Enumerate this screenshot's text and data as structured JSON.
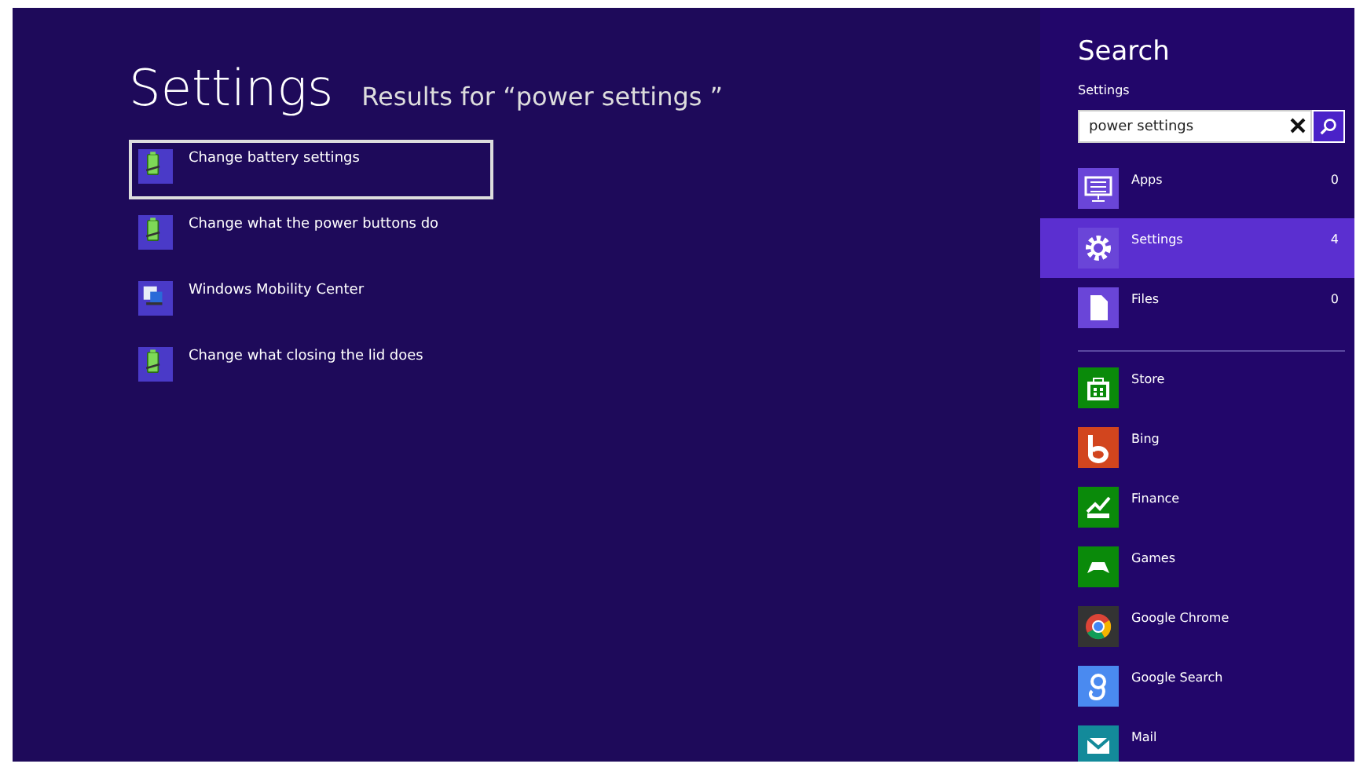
{
  "title": "Settings",
  "subtitle": "Results for “power settings ”",
  "results": [
    {
      "label": "Change battery settings",
      "kind": "battery",
      "selected": true
    },
    {
      "label": "Change what the power buttons do",
      "kind": "battery",
      "selected": false
    },
    {
      "label": "Windows Mobility Center",
      "kind": "mobility",
      "selected": false
    },
    {
      "label": "Change what closing the lid does",
      "kind": "battery",
      "selected": false
    }
  ],
  "search_pane": {
    "title": "Search",
    "scope": "Settings",
    "query": "power settings",
    "scopes": [
      {
        "label": "Apps",
        "count": "0",
        "kind": "apps",
        "selected": false
      },
      {
        "label": "Settings",
        "count": "4",
        "kind": "settings",
        "selected": true
      },
      {
        "label": "Files",
        "count": "0",
        "kind": "files",
        "selected": false
      }
    ],
    "apps": [
      {
        "label": "Store",
        "kind": "store",
        "color": "#0a8a0a"
      },
      {
        "label": "Bing",
        "kind": "bing",
        "color": "#d2451e"
      },
      {
        "label": "Finance",
        "kind": "finance",
        "color": "#0a8a0a"
      },
      {
        "label": "Games",
        "kind": "games",
        "color": "#0a8a0a"
      },
      {
        "label": "Google Chrome",
        "kind": "chrome",
        "color": "#333333"
      },
      {
        "label": "Google Search",
        "kind": "google",
        "color": "#4a8af0"
      },
      {
        "label": "Mail",
        "kind": "mail",
        "color": "#138a9a"
      }
    ]
  }
}
